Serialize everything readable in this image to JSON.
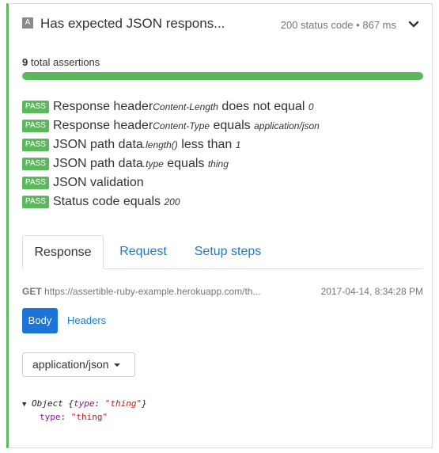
{
  "header": {
    "badge": "A",
    "title": "Has expected JSON respons...",
    "status": "200 status code",
    "separator": "•",
    "duration": "867 ms"
  },
  "summary": {
    "count": "9",
    "label": "total assertions",
    "progress_percent": 100
  },
  "assertions": [
    {
      "status": "PASS",
      "prefix": "Response header ",
      "em": "Content-Length",
      "middle": " does not equal ",
      "value": "0"
    },
    {
      "status": "PASS",
      "prefix": "Response header ",
      "em": "Content-Type",
      "middle": " equals ",
      "value": "application/json"
    },
    {
      "status": "PASS",
      "prefix": "JSON path data ",
      "em": ".length()",
      "middle": " less than ",
      "value": "1"
    },
    {
      "status": "PASS",
      "prefix": "JSON path data ",
      "em": ".type",
      "middle": " equals ",
      "value": "thing"
    },
    {
      "status": "PASS",
      "prefix": "JSON validation",
      "em": "",
      "middle": "",
      "value": ""
    },
    {
      "status": "PASS",
      "prefix": "Status code equals ",
      "em": "",
      "middle": "",
      "value": "200"
    }
  ],
  "tabs": [
    {
      "label": "Response",
      "active": true
    },
    {
      "label": "Request",
      "active": false
    },
    {
      "label": "Setup steps",
      "active": false
    }
  ],
  "request": {
    "method": "GET",
    "url": "https://assertible-ruby-example.herokuapp.com/th...",
    "timestamp": "2017-04-14, 8:34:28 PM"
  },
  "subtabs": {
    "body": "Body",
    "headers": "Headers"
  },
  "content_type_select": {
    "value": "application/json"
  },
  "json_view": {
    "line1_prefix": "Object {",
    "line1_key": "type",
    "line1_sep": ": ",
    "line1_value": "\"thing\"",
    "line1_suffix": "}",
    "line2_key": "type",
    "line2_sep": ": ",
    "line2_value": "\"thing\""
  },
  "colors": {
    "pass": "#5cb85c",
    "accent": "#1b74d6",
    "link": "#1a7bd0"
  }
}
